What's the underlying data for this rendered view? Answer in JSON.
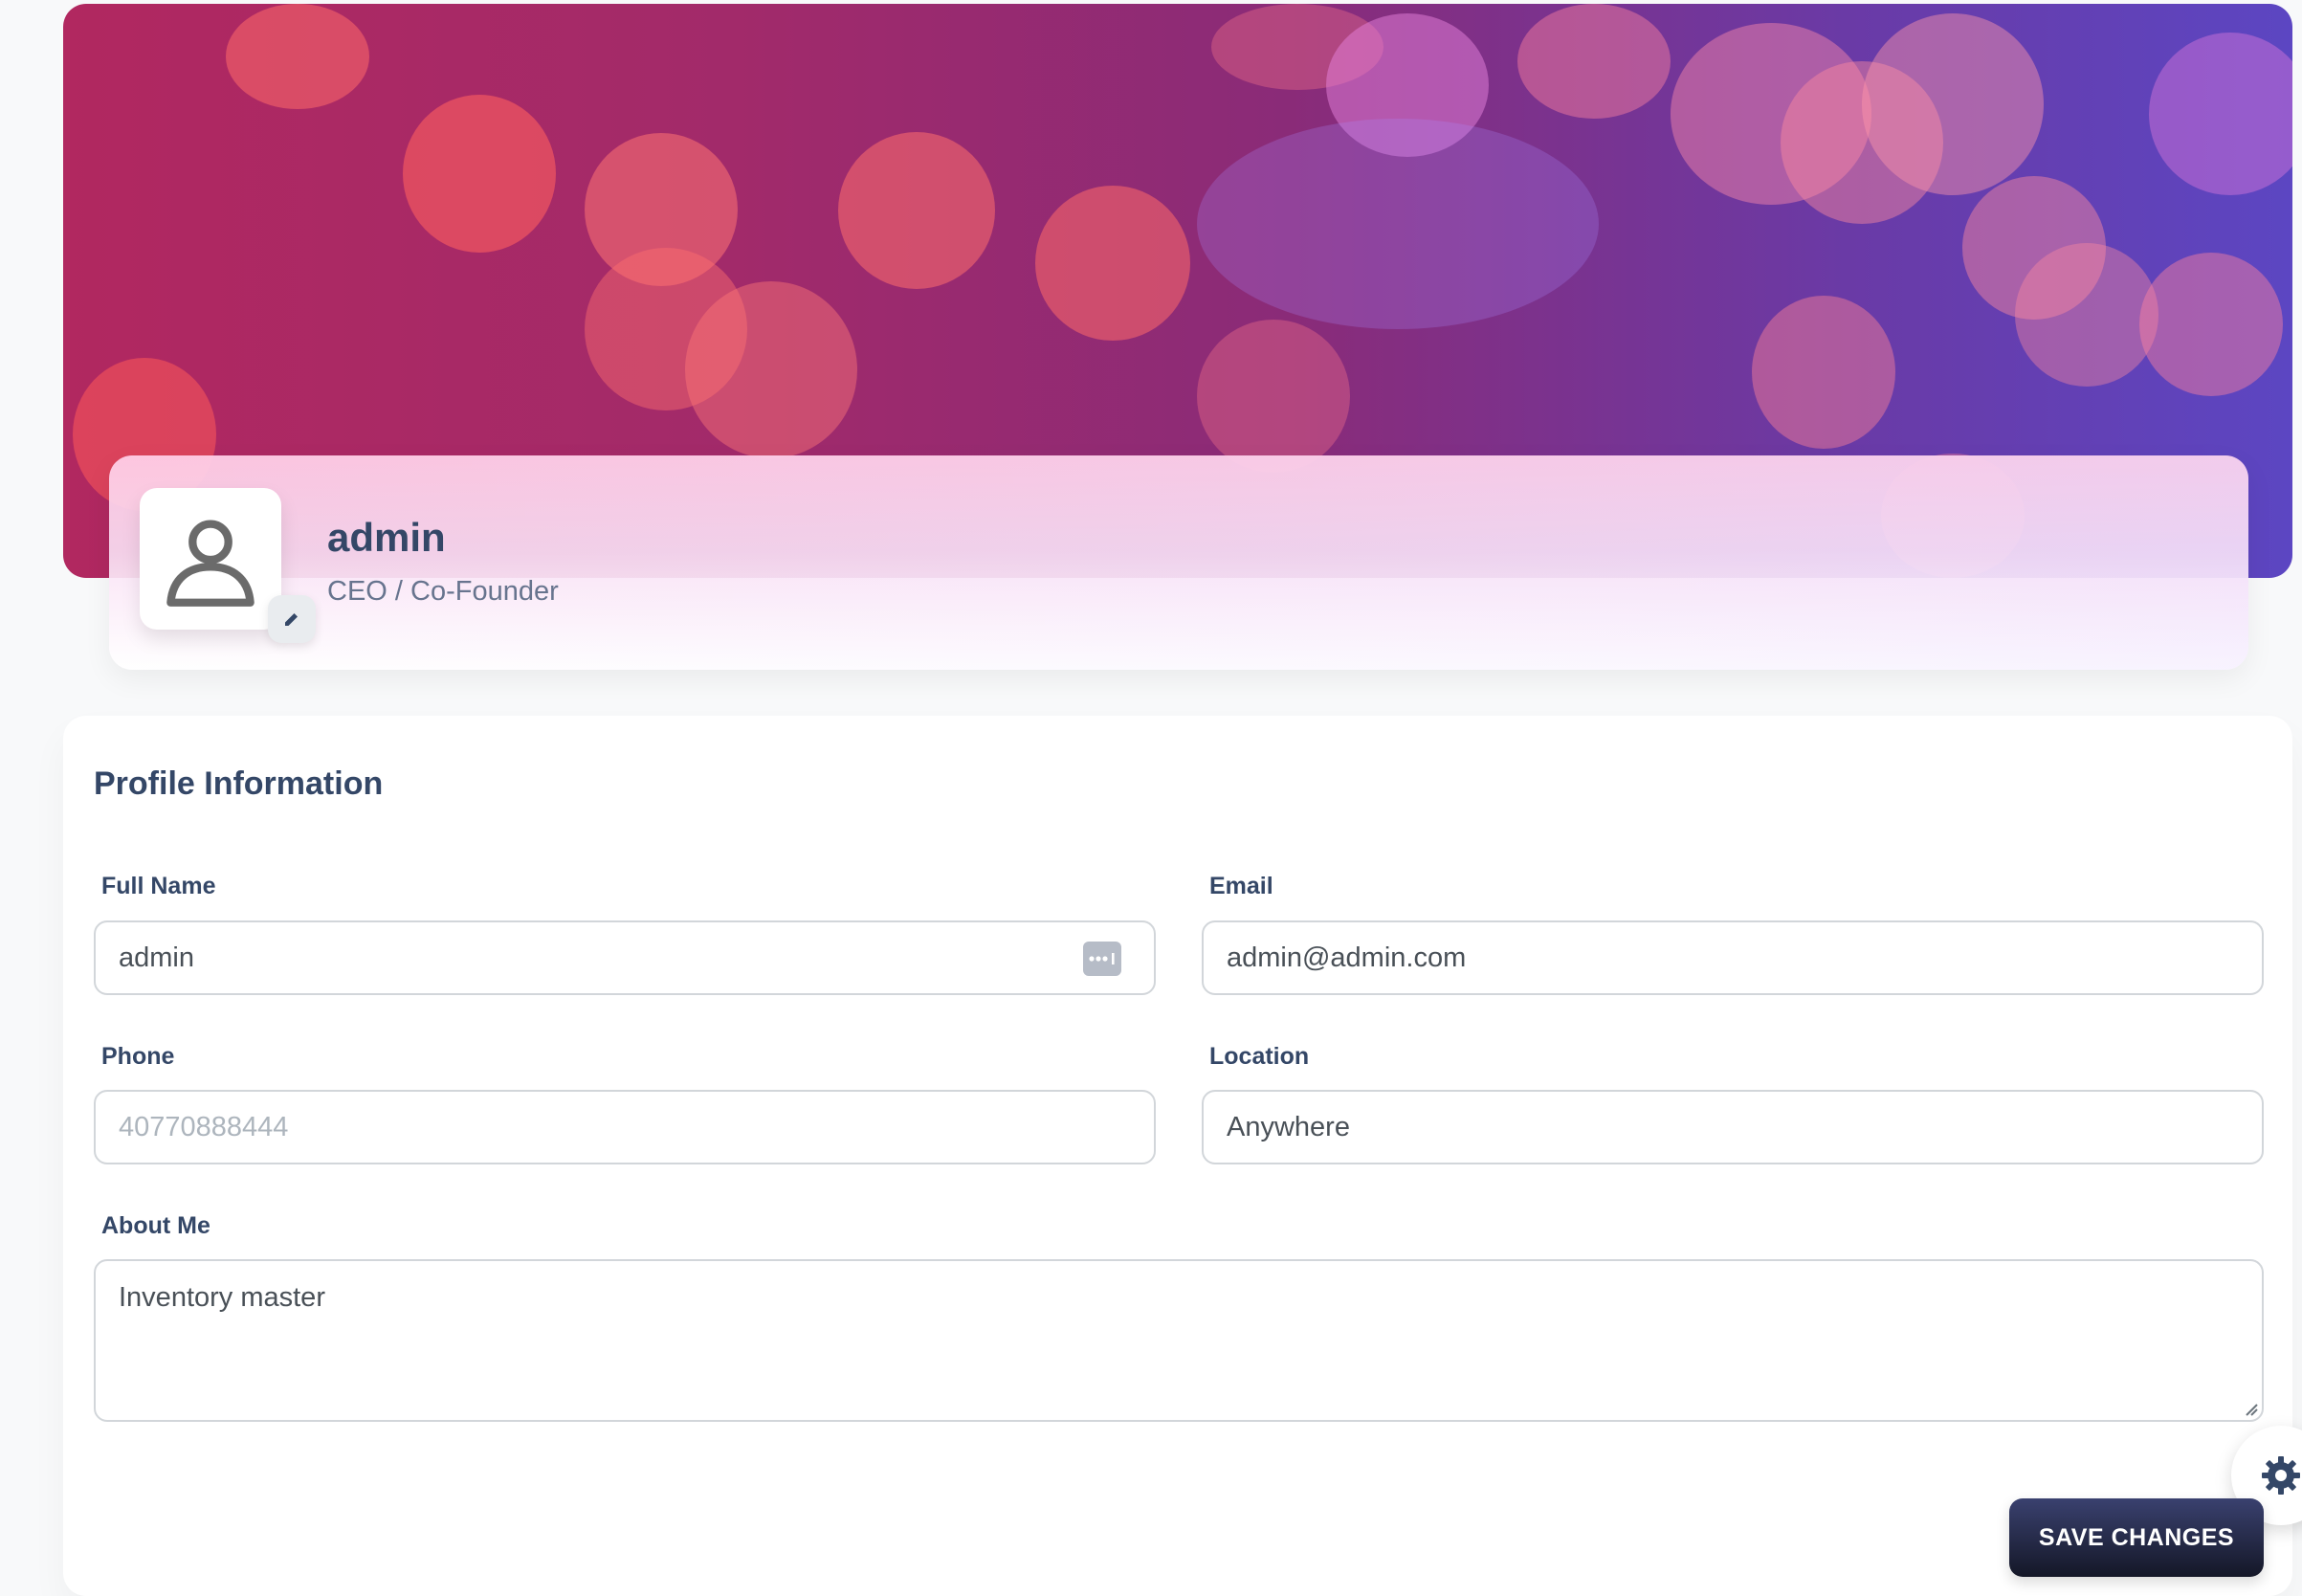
{
  "profile": {
    "name": "admin",
    "role": "CEO / Co-Founder"
  },
  "form": {
    "title": "Profile Information",
    "full_name": {
      "label": "Full Name",
      "value": "admin"
    },
    "email": {
      "label": "Email",
      "value": "admin@admin.com"
    },
    "phone": {
      "label": "Phone",
      "placeholder": "40770888444"
    },
    "location": {
      "label": "Location",
      "value": "Anywhere"
    },
    "about": {
      "label": "About Me",
      "value": "Inventory master"
    },
    "save_label": "SAVE CHANGES"
  },
  "icons": {
    "avatar": "user-icon",
    "edit": "pencil-icon",
    "password_manager": "password-dots-icon",
    "settings": "gear-icon"
  },
  "colors": {
    "primary_text": "#344767",
    "secondary_text": "#67748e",
    "button_gradient_start": "#3a416f",
    "button_gradient_end": "#141727",
    "banner_start": "#b12860",
    "banner_end": "#5c46c2"
  }
}
